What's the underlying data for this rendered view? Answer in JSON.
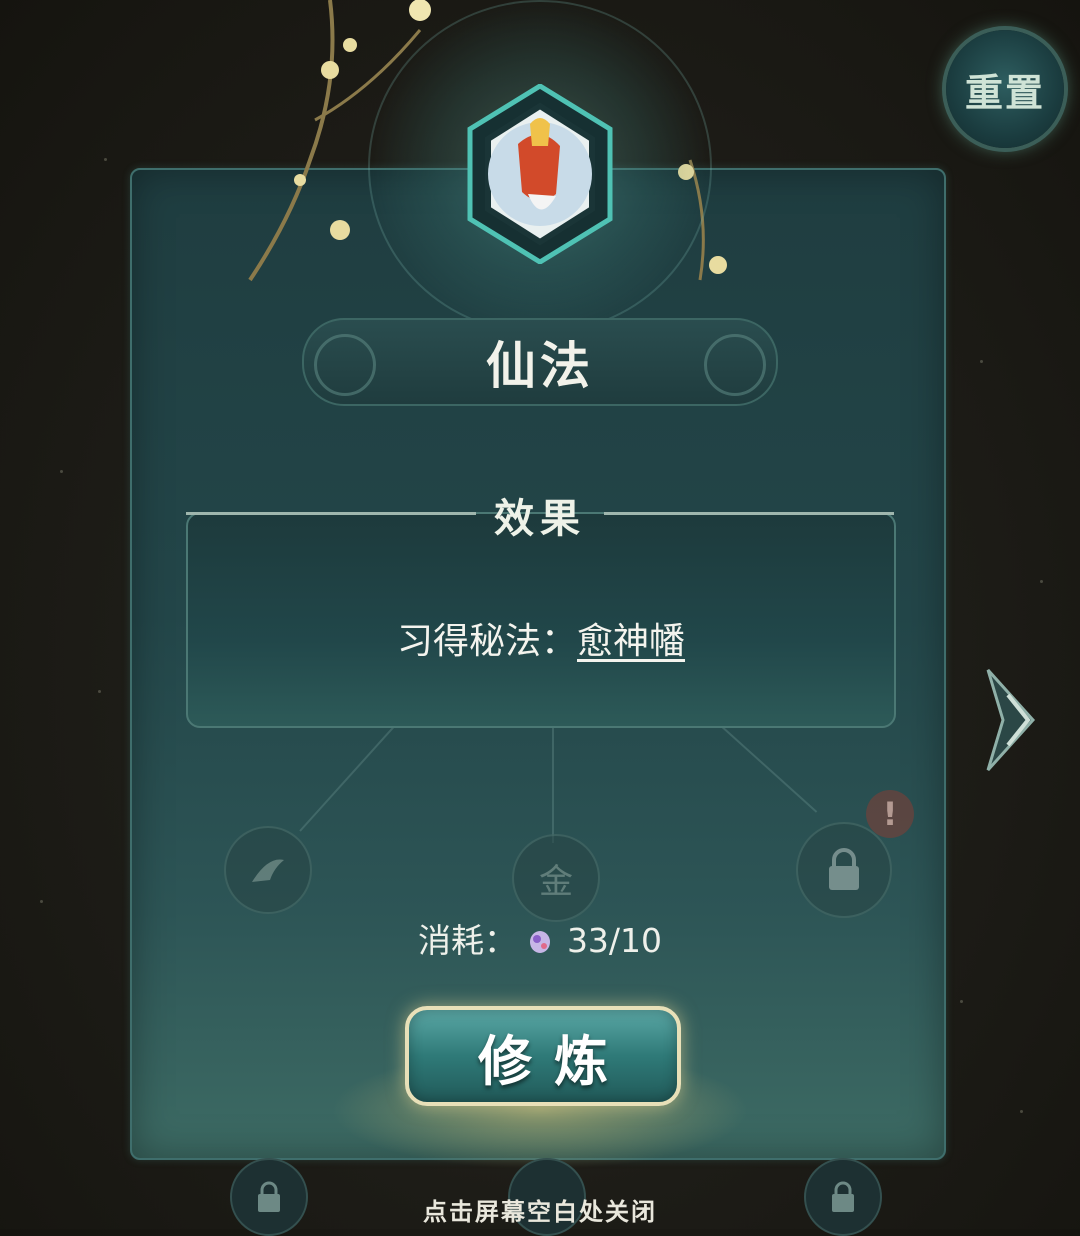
{
  "reset_button": {
    "label": "重置",
    "icon": "reset-seal-icon"
  },
  "skill": {
    "name": "仙法",
    "icon": "immortal-banner-emblem-icon"
  },
  "effect": {
    "header": "效果",
    "prefix": "习得秘法：",
    "link_text": "愈神幡"
  },
  "cost": {
    "label": "消耗：",
    "item_icon": "spirit-gem-icon",
    "value": "33/10"
  },
  "cultivate_button": {
    "label": "修炼"
  },
  "close_hint": "点击屏幕空白处关闭",
  "tree_nodes": [
    {
      "name": "crane-node",
      "icon": "crane-icon",
      "state": "faded"
    },
    {
      "name": "gold-node",
      "icon": "gold-character-icon",
      "glyph": "金",
      "state": "faded"
    },
    {
      "name": "locked-node",
      "icon": "lock-icon",
      "state": "locked"
    }
  ],
  "alert_badge": "!",
  "colors": {
    "panel": "#234649",
    "accent_teal": "#2f7a78",
    "button_border": "#e8e0b8",
    "text": "#f4f4ee"
  }
}
